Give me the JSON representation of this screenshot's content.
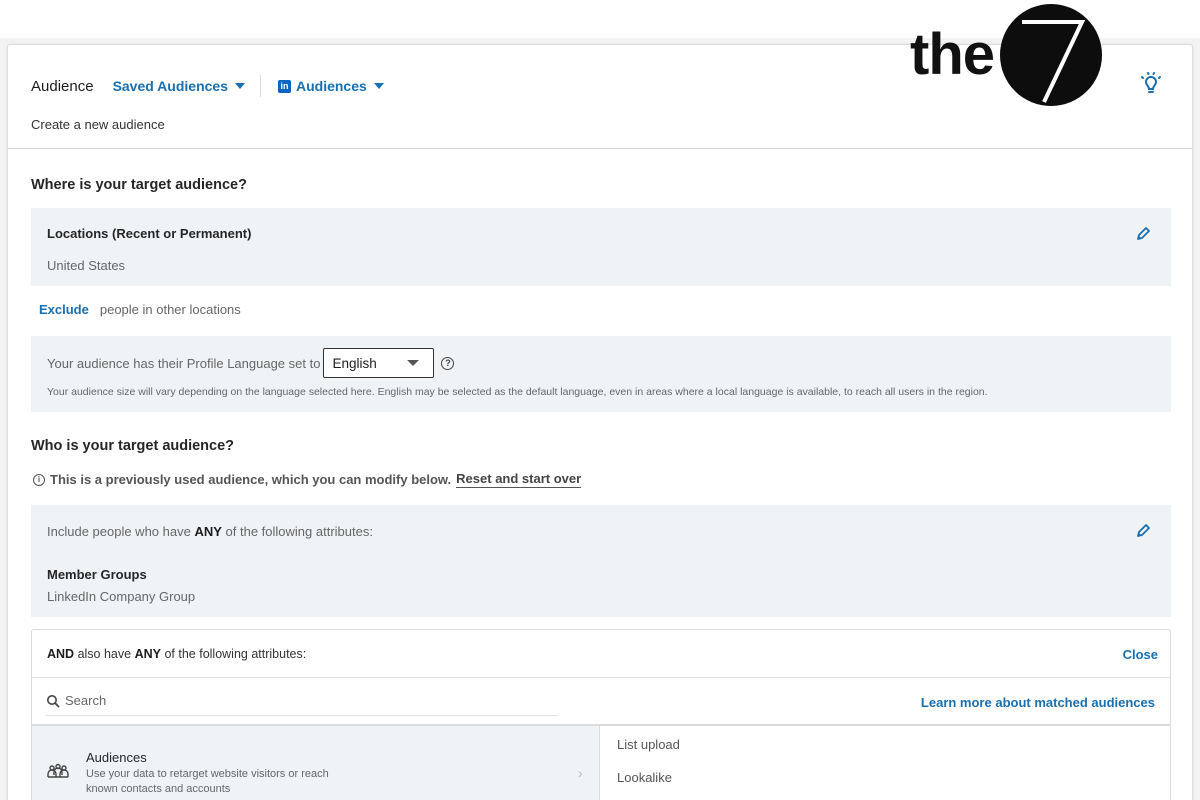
{
  "header": {
    "title": "Audience",
    "saved_audiences": "Saved Audiences",
    "audiences_menu": "Audiences",
    "linkedin_logo_text": "in",
    "subtitle": "Create a new audience",
    "tip_icon": "lightbulb-icon"
  },
  "brand": {
    "text": "the",
    "mark": "7"
  },
  "where": {
    "heading": "Where is your target audience?",
    "locations_label": "Locations (Recent or Permanent)",
    "locations_value": "United States",
    "exclude_link": "Exclude",
    "exclude_text": "people in other locations",
    "language_prefix": "Your audience has their Profile Language set to",
    "language_selected": "English",
    "language_help_icon": "?",
    "language_note": "Your audience size will vary depending on the language selected here. English may be selected as the default language, even in areas where a local language is available, to reach all users in the region."
  },
  "who": {
    "heading": "Who is your target audience?",
    "info_icon": "i",
    "info_text": "This is a previously used audience, which you can modify below.",
    "reset_link": "Reset and start over",
    "include_prefix": "Include people who have",
    "include_emphasis": "ANY",
    "include_suffix": "of the following attributes:",
    "group_label": "Member Groups",
    "group_value": "LinkedIn Company Group"
  },
  "and_box": {
    "and_word": "AND",
    "text_mid": "also have",
    "any_word": "ANY",
    "text_end": "of the following attributes:",
    "close": "Close",
    "search_placeholder": "Search",
    "learn_more": "Learn more about matched audiences",
    "category": {
      "title": "Audiences",
      "description": "Use your data to retarget website visitors or reach known contacts and accounts",
      "chevron": "›"
    },
    "sub_items": [
      "List upload",
      "Lookalike"
    ]
  }
}
